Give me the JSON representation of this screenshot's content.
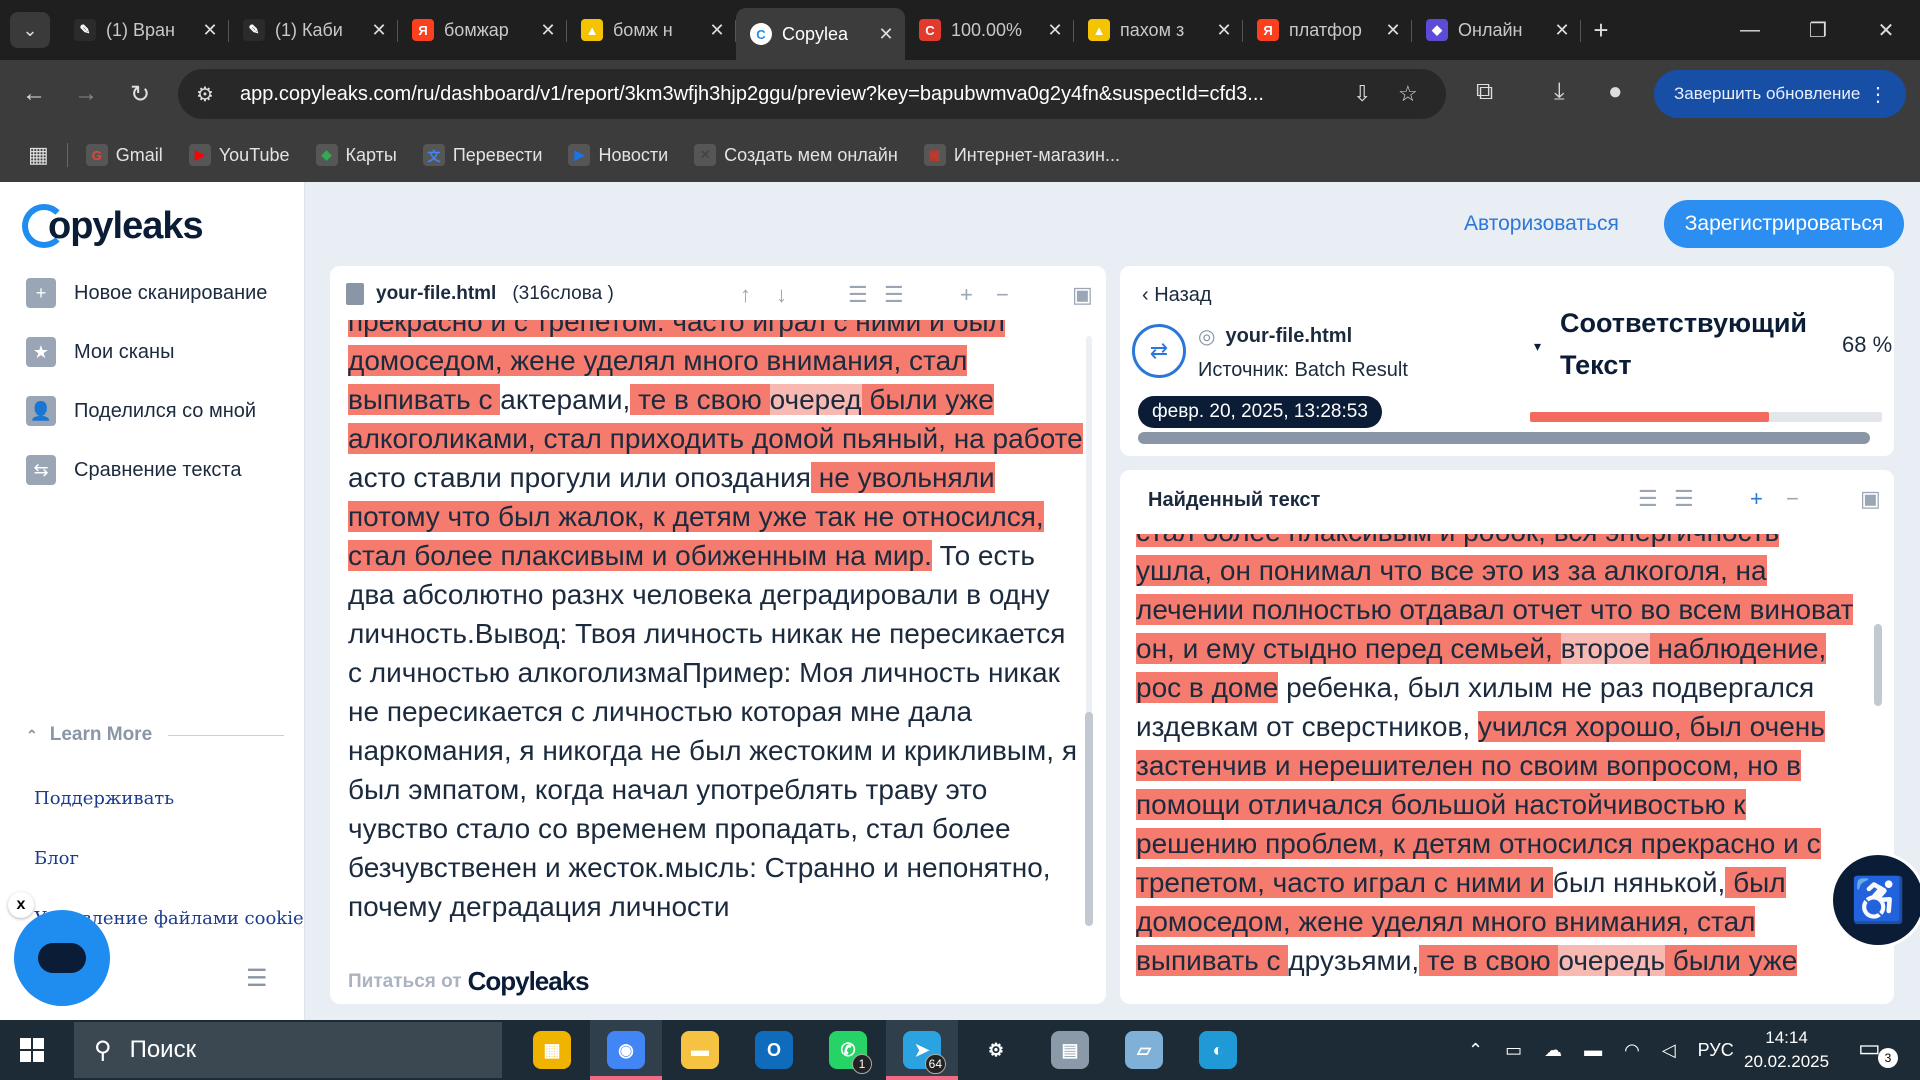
{
  "browser": {
    "tabs": [
      {
        "title": "(1) Вран",
        "fav_color": "#2b2b2b",
        "fav_glyph": "✎",
        "active": false
      },
      {
        "title": "(1) Каби",
        "fav_color": "#2b2b2b",
        "fav_glyph": "✎",
        "active": false
      },
      {
        "title": "бомжар",
        "fav_color": "#fc3f1d",
        "fav_glyph": "Я",
        "active": false
      },
      {
        "title": "бомж н",
        "fav_color": "#f5c400",
        "fav_glyph": "▲",
        "active": false
      },
      {
        "title": "Copylea",
        "fav_color": "#ffffff",
        "fav_glyph": "C",
        "active": true
      },
      {
        "title": "100.00%",
        "fav_color": "#e23b2e",
        "fav_glyph": "C",
        "active": false
      },
      {
        "title": "пахом з",
        "fav_color": "#f5c400",
        "fav_glyph": "▲",
        "active": false
      },
      {
        "title": "платфор",
        "fav_color": "#fc3f1d",
        "fav_glyph": "Я",
        "active": false
      },
      {
        "title": "Онлайн",
        "fav_color": "#5c4bd6",
        "fav_glyph": "◆",
        "active": false
      }
    ],
    "url": "app.copyleaks.com/ru/dashboard/v1/report/3km3wfjh3hjp2ggu/preview?key=bapubwmva0g2y4fn&suspectId=cfd3...",
    "update_button": "Завершить обновление",
    "bookmarks": [
      {
        "label": "Gmail",
        "color": "#ea4335",
        "glyph": "G"
      },
      {
        "label": "YouTube",
        "color": "#ff0000",
        "glyph": "▶"
      },
      {
        "label": "Карты",
        "color": "#34a853",
        "glyph": "◆"
      },
      {
        "label": "Перевести",
        "color": "#4285f4",
        "glyph": "文"
      },
      {
        "label": "Новости",
        "color": "#1a73e8",
        "glyph": "▶"
      },
      {
        "label": "Создать мем онлайн",
        "color": "#444444",
        "glyph": "✕"
      },
      {
        "label": "Интернет-магазин...",
        "color": "#c0392b",
        "glyph": "▣"
      }
    ]
  },
  "sidebar": {
    "logo": "opyleaks",
    "items": [
      {
        "label": "Новое сканирование",
        "icon": "new-scan-icon",
        "glyph": "+"
      },
      {
        "label": "Мои сканы",
        "icon": "folder-star-icon",
        "glyph": "★"
      },
      {
        "label": "Поделился со мной",
        "icon": "shared-folder-icon",
        "glyph": "👤"
      },
      {
        "label": "Сравнение текста",
        "icon": "compare-icon",
        "glyph": "⇆"
      }
    ],
    "learn_more": "Learn More",
    "links": [
      "Поддерживать",
      "Блог",
      "Управление файлами cookie"
    ],
    "cookie_close": "x"
  },
  "header": {
    "login": "Авторизоваться",
    "register": "Зарегистрироваться"
  },
  "left_panel": {
    "filename": "your-file.html",
    "word_count": "(316слова )",
    "powered_by": "Питаться от",
    "powered_logo": "Copyleaks",
    "text_segments": [
      {
        "t": "прекрасно и с трепетом. часто играл с ними и был домоседом, жене уделял много внимания, стал выпивать с ",
        "h": 1
      },
      {
        "t": "актерами,",
        "h": 0
      },
      {
        "t": " те в свою ",
        "h": 1
      },
      {
        "t": "очеред",
        "h": 2
      },
      {
        "t": " были уже алкоголиками, стал приходить домой пьяный, на работе ",
        "h": 1
      },
      {
        "t": "асто ставли прогули или опоздания",
        "h": 0
      },
      {
        "t": " не увольняли потому что был жалок, к детям уже так не относился, стал более плаксивым и обиженным на мир.",
        "h": 1
      },
      {
        "t": " То есть два абсолютно разнх человека деградировали в одну личность.Вывод: Твоя личность никак не пересикается с личностью алкоголизмаПример: Моя личность никак не пересикается с личностью которая мне дала наркомания, я никогда не был жестоким и крикливым, я был эмпатом, когда начал употреблять траву это чувство стало со временем пропадать, стал более безчувственен и жесток.мысль: Странно и непонятно, почему деградация личности",
        "h": 0
      }
    ]
  },
  "right_top": {
    "back": "Назад",
    "filename": "your-file.html",
    "source": "Источник: Batch Result",
    "date": "февр. 20, 2025, 13:28:53",
    "match_title": "Соответствующий Текст",
    "percent": "68 %",
    "match_fraction": 0.68
  },
  "right_bottom": {
    "title": "Найденный текст",
    "text_segments": [
      {
        "t": "стал более плаксивым и робок, вся энергичность ушла, он понимал что все это из за алкоголя, на лечении полностью отдавал отчет что во всем виноват он, и ему стыдно перед семьей, ",
        "h": 1
      },
      {
        "t": "второе",
        "h": 2
      },
      {
        "t": " наблюдение, рос в доме",
        "h": 1
      },
      {
        "t": " ребенка, был хилым не раз подвергался издевкам от сверстников, ",
        "h": 0
      },
      {
        "t": "учился хорошо, был очень застенчив и нерешителен по своим вопросом, но в помощи отличался большой настойчивостью к решению проблем, к детям относился прекрасно и с трепетом, часто играл с ними и ",
        "h": 1
      },
      {
        "t": "был нянькой,",
        "h": 0
      },
      {
        "t": " был домоседом, жене уделял много внимания, стал выпивать с ",
        "h": 1
      },
      {
        "t": "друзьями,",
        "h": 0
      },
      {
        "t": " те в свою ",
        "h": 1
      },
      {
        "t": "очередь",
        "h": 2
      },
      {
        "t": " были уже",
        "h": 1
      }
    ]
  },
  "taskbar": {
    "search": "Поиск",
    "apps": [
      {
        "name": "store-icon",
        "color": "#f0b400",
        "glyph": "▦",
        "active": false
      },
      {
        "name": "chrome-icon",
        "color": "#4285f4",
        "glyph": "◉",
        "active": true
      },
      {
        "name": "explorer-icon",
        "color": "#f5c242",
        "glyph": "▬",
        "active": false
      },
      {
        "name": "outlook-icon",
        "color": "#0f6cbd",
        "glyph": "O",
        "active": false
      },
      {
        "name": "whatsapp-icon",
        "color": "#25d366",
        "glyph": "✆",
        "active": false,
        "badge": "1"
      },
      {
        "name": "telegram-icon",
        "color": "#2aa3e0",
        "glyph": "➤",
        "active": true,
        "badge": "64"
      },
      {
        "name": "settings-icon",
        "color": "#1c2b36",
        "glyph": "⚙",
        "active": false
      },
      {
        "name": "monitor-icon",
        "color": "#8a9aa8",
        "glyph": "▤",
        "active": false
      },
      {
        "name": "notepad-icon",
        "color": "#7fb0d8",
        "glyph": "▱",
        "active": false
      },
      {
        "name": "edge-icon",
        "color": "#1f9ad6",
        "glyph": "◐",
        "active": false
      }
    ],
    "lang": "РУС",
    "time": "14:14",
    "date": "20.02.2025",
    "notif_count": "3"
  }
}
